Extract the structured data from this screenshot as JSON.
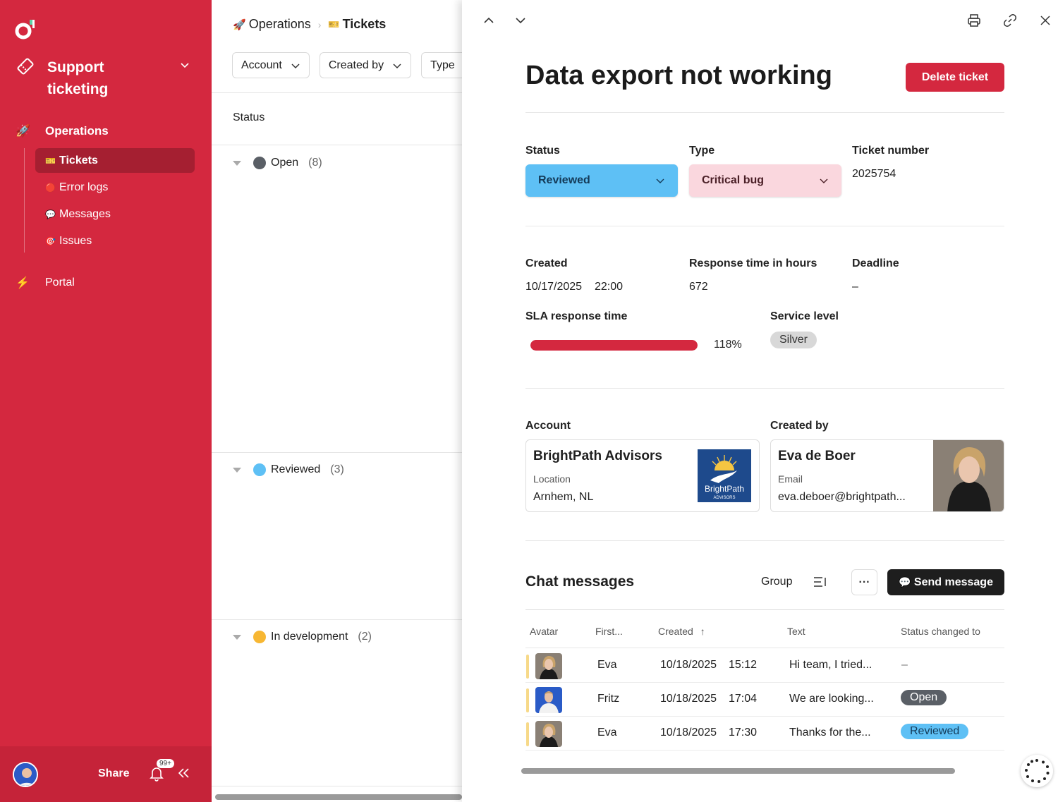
{
  "sidebar": {
    "workspace_name": "Support ticketing",
    "section": {
      "emoji": "🚀",
      "label": "Operations"
    },
    "items": [
      {
        "emoji": "🎫",
        "label": "Tickets",
        "active": true
      },
      {
        "emoji": "🔴",
        "label": "Error logs",
        "active": false
      },
      {
        "emoji": "💬",
        "label": "Messages",
        "active": false
      },
      {
        "emoji": "🎯",
        "label": "Issues",
        "active": false
      }
    ],
    "portal": {
      "emoji": "⚡",
      "label": "Portal"
    },
    "footer": {
      "share_label": "Share",
      "notification_badge": "99+"
    },
    "colors": {
      "background": "#d4283f",
      "active_item": "#a51f31"
    }
  },
  "list": {
    "breadcrumb": [
      {
        "emoji": "🚀",
        "label": "Operations"
      },
      {
        "emoji": "🎫",
        "label": "Tickets"
      }
    ],
    "filters": [
      "Account",
      "Created by",
      "Type"
    ],
    "column_header": "Status",
    "groups": [
      {
        "label": "Open",
        "count": "(8)",
        "color": "#5a5f66"
      },
      {
        "label": "Reviewed",
        "count": "(3)",
        "color": "#5ec0f5"
      },
      {
        "label": "In development",
        "count": "(2)",
        "color": "#f7b733"
      }
    ]
  },
  "detail": {
    "title": "Data export not working",
    "delete_label": "Delete ticket",
    "status": {
      "label": "Status",
      "value": "Reviewed",
      "color": "#5ec0f5"
    },
    "type": {
      "label": "Type",
      "value": "Critical bug",
      "color": "#fad7de"
    },
    "ticket_number": {
      "label": "Ticket number",
      "value": "2025754"
    },
    "created": {
      "label": "Created",
      "date": "10/17/2025",
      "time": "22:00"
    },
    "response_time": {
      "label": "Response time in hours",
      "value": "672"
    },
    "deadline": {
      "label": "Deadline",
      "value": "–"
    },
    "sla": {
      "label": "SLA response time",
      "percent_text": "118%",
      "fill_fraction": 1.0
    },
    "service_level": {
      "label": "Service level",
      "value": "Silver"
    },
    "account": {
      "label": "Account",
      "name": "BrightPath Advisors",
      "field_label": "Location",
      "field_value": "Arnhem, NL",
      "logo_text": "BrightPath",
      "logo_subtext": "ADVISORS"
    },
    "created_by": {
      "label": "Created by",
      "name": "Eva de Boer",
      "field_label": "Email",
      "field_value": "eva.deboer@brightpath..."
    },
    "chat": {
      "title": "Chat messages",
      "group_label": "Group",
      "more_label": "···",
      "send_label": "Send message",
      "columns": [
        "Avatar",
        "First...",
        "Created",
        "Text",
        "Status changed to"
      ],
      "rows": [
        {
          "first": "Eva",
          "date": "10/18/2025",
          "time": "15:12",
          "text": "Hi team, I tried...",
          "status": "–",
          "avatar": "eva"
        },
        {
          "first": "Fritz",
          "date": "10/18/2025",
          "time": "17:04",
          "text": "We are looking...",
          "status": "Open",
          "avatar": "fritz"
        },
        {
          "first": "Eva",
          "date": "10/18/2025",
          "time": "17:30",
          "text": "Thanks for the...",
          "status": "Reviewed",
          "avatar": "eva"
        }
      ]
    }
  }
}
